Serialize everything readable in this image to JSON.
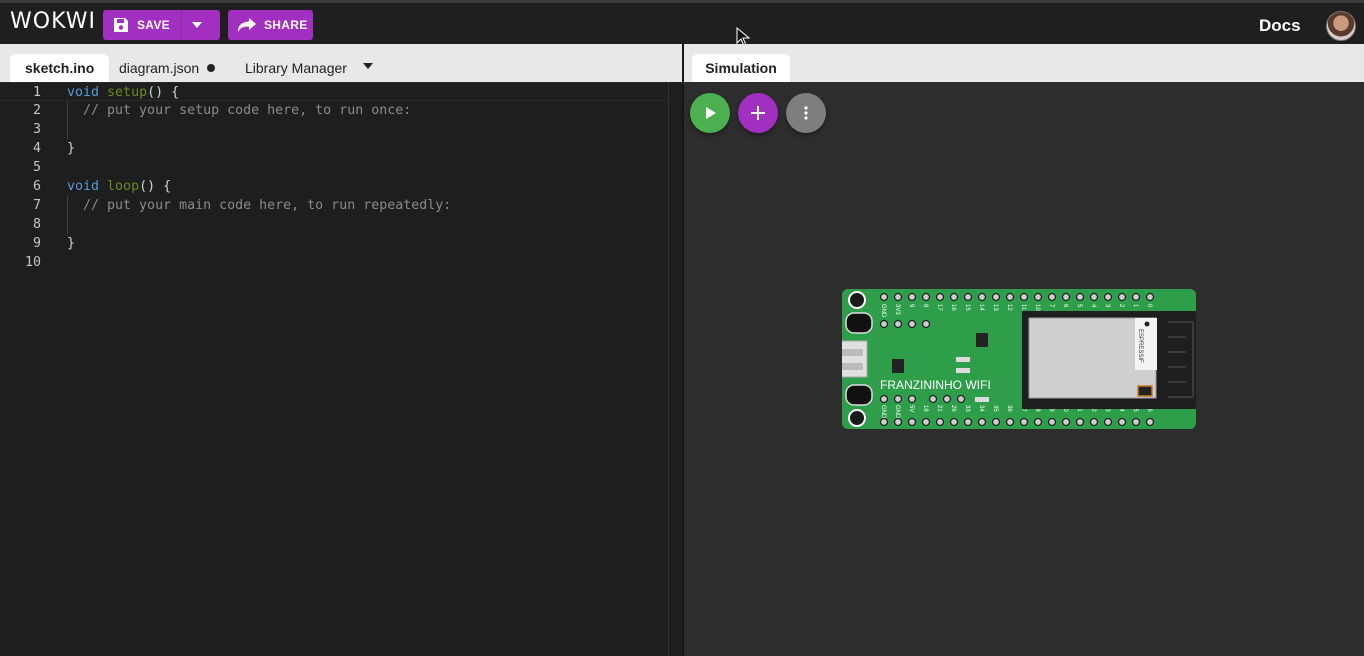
{
  "app": {
    "logo": "WOKWI",
    "save_label": "SAVE",
    "share_label": "SHARE",
    "docs_label": "Docs"
  },
  "editor": {
    "tabs": [
      {
        "label": "sketch.ino",
        "active": true
      },
      {
        "label": "diagram.json",
        "modified": true
      },
      {
        "label": "Library Manager"
      }
    ],
    "lines": [
      {
        "n": "1",
        "parts": [
          [
            "kw",
            "void"
          ],
          [
            "tx",
            " "
          ],
          [
            "fn",
            "setup"
          ],
          [
            "tx",
            "() {"
          ]
        ]
      },
      {
        "n": "2",
        "parts": [
          [
            "tx",
            "  "
          ],
          [
            "cm",
            "// put your setup code here, to run once:"
          ]
        ]
      },
      {
        "n": "3",
        "parts": []
      },
      {
        "n": "4",
        "parts": [
          [
            "tx",
            "}"
          ]
        ]
      },
      {
        "n": "5",
        "parts": []
      },
      {
        "n": "6",
        "parts": [
          [
            "kw",
            "void"
          ],
          [
            "tx",
            " "
          ],
          [
            "fn",
            "loop"
          ],
          [
            "tx",
            "() {"
          ]
        ]
      },
      {
        "n": "7",
        "parts": [
          [
            "tx",
            "  "
          ],
          [
            "cm",
            "// put your main code here, to run repeatedly:"
          ]
        ]
      },
      {
        "n": "8",
        "parts": []
      },
      {
        "n": "9",
        "parts": [
          [
            "tx",
            "}"
          ]
        ]
      },
      {
        "n": "10",
        "parts": []
      }
    ]
  },
  "simulation": {
    "tab_label": "Simulation",
    "board": {
      "label": "FRANZININHO WIFI",
      "top_pins": [
        "GND",
        "3V3",
        "9",
        "8",
        "17",
        "16",
        "15",
        "14",
        "13",
        "12",
        "11",
        "10",
        "7",
        "6",
        "5",
        "4",
        "3",
        "2",
        "1",
        "0"
      ],
      "bottom_pins": [
        "GND",
        "GND",
        "5V",
        "18",
        "21",
        "26",
        "33",
        "34",
        "35",
        "36",
        "37",
        "38",
        "39",
        "40",
        "41",
        "42",
        "43",
        "44",
        "45",
        "46"
      ],
      "module_text": "ESPRESSIF"
    }
  },
  "colors": {
    "accent": "#a12fbf",
    "run": "#4caf50",
    "board": "#2e9e4a"
  }
}
